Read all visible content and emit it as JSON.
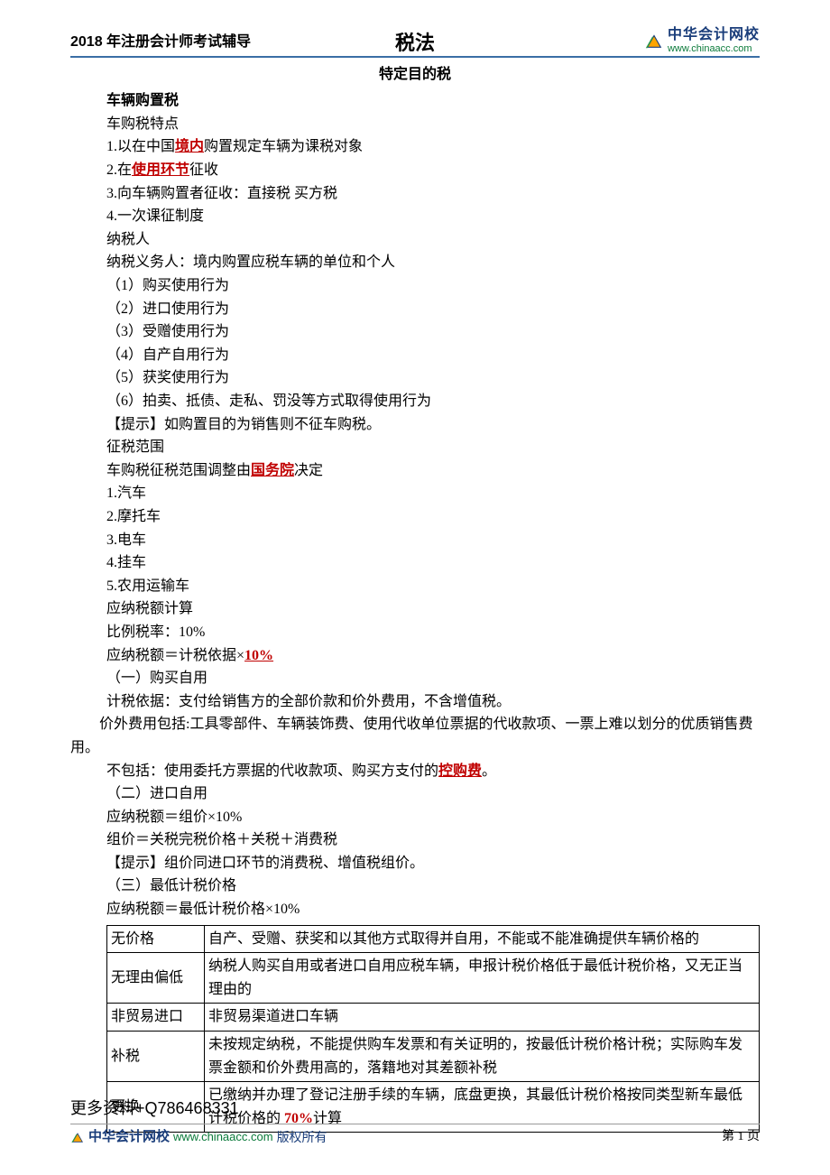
{
  "header": {
    "left": "2018 年注册会计师考试辅导",
    "center": "税法",
    "logo_cn": "中华会计网校",
    "logo_url": "www.chinaacc.com"
  },
  "doc": {
    "title": "特定目的税",
    "h1": "车辆购置税",
    "s1": "车购税特点",
    "p1_pre": "1.以在中国",
    "p1_red": "境内",
    "p1_post": "购置规定车辆为课税对象",
    "p2_pre": "2.在",
    "p2_red": "使用环节",
    "p2_post": "征收",
    "p3": "3.向车辆购置者征收：直接税  买方税",
    "p4": "4.一次课征制度",
    "s2": "纳税人",
    "s2a": "纳税义务人：境内购置应税车辆的单位和个人",
    "b1": "（1）购买使用行为",
    "b2": "（2）进口使用行为",
    "b3": "（3）受赠使用行为",
    "b4": "（4）自产自用行为",
    "b5": "（5）获奖使用行为",
    "b6": "（6）拍卖、抵债、走私、罚没等方式取得使用行为",
    "tip1": "【提示】如购置目的为销售则不征车购税。",
    "s3": "征税范围",
    "s3a_pre": "车购税征税范围调整由",
    "s3a_red": "国务院",
    "s3a_post": "决定",
    "c1": "1.汽车",
    "c2": "2.摩托车",
    "c3": "3.电车",
    "c4": "4.挂车",
    "c5": "5.农用运输车",
    "s4": "应纳税额计算",
    "s4a": "比例税率：10%",
    "s4b_pre": "应纳税额＝计税依据×",
    "s4b_red": "10%",
    "s5": "（一）购买自用",
    "s5a": "计税依据：支付给销售方的全部价款和价外费用，不含增值税。",
    "s5b": "价外费用包括:工具零部件、车辆装饰费、使用代收单位票据的代收款项、一票上难以划分的优质销售费用。",
    "s5c_pre": "不包括：使用委托方票据的代收款项、购买方支付的",
    "s5c_red": "控购费",
    "s5c_post": "。",
    "s6": "（二）进口自用",
    "s6a": "应纳税额＝组价×10%",
    "s6b": "组价＝关税完税价格＋关税＋消费税",
    "tip2": "【提示】组价同进口环节的消费税、增值税组价。",
    "s7": "（三）最低计税价格",
    "s7a": "应纳税额＝最低计税价格×10%"
  },
  "table": {
    "r1": {
      "label": "无价格",
      "desc": "自产、受赠、获奖和以其他方式取得并自用，不能或不能准确提供车辆价格的"
    },
    "r2": {
      "label": "无理由偏低",
      "desc": "纳税人购买自用或者进口自用应税车辆，申报计税价格低于最低计税价格，又无正当理由的"
    },
    "r3": {
      "label": "非贸易进口",
      "desc": "非贸易渠道进口车辆"
    },
    "r4": {
      "label": "补税",
      "desc": "未按规定纳税，不能提供购车发票和有关证明的，按最低计税价格计税；实际购车发票金额和价外费用高的，落籍地对其差额补税"
    },
    "r5": {
      "label": "更换",
      "desc_pre": "已缴纳并办理了登记注册手续的车辆，底盘更换，其最低计税价格按同类型新车最低计税价格的 ",
      "desc_red": "70%",
      "desc_post": "计算"
    }
  },
  "footer": {
    "contact": "更多资料+Q786468331",
    "logo_cn": "中华会计网校",
    "url": "www.chinaacc.com",
    "copy": "版权所有",
    "page": "第 1 页"
  }
}
